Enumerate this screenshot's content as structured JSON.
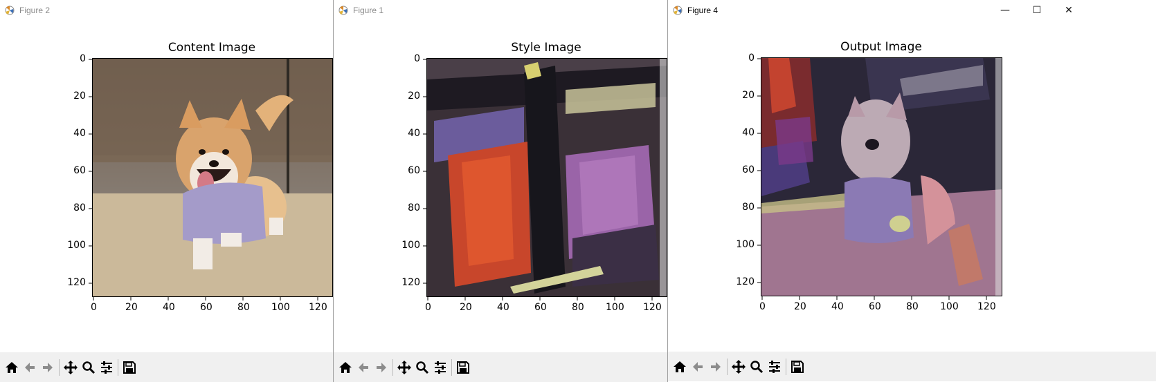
{
  "windows": [
    {
      "title": "Figure 2",
      "active": false,
      "plot_title": "Content Image",
      "image_subject": "corgi puppy in lavender shirt running on dry grass",
      "x_ticks": [
        "0",
        "20",
        "40",
        "60",
        "80",
        "100",
        "120"
      ],
      "y_ticks": [
        "0",
        "20",
        "40",
        "60",
        "80",
        "100",
        "120"
      ]
    },
    {
      "title": "Figure 1",
      "active": false,
      "plot_title": "Style Image",
      "image_subject": "abstract painting with dark cross, red and purple brushstrokes",
      "x_ticks": [
        "0",
        "20",
        "40",
        "60",
        "80",
        "100",
        "120"
      ],
      "y_ticks": [
        "0",
        "20",
        "40",
        "60",
        "80",
        "100",
        "120"
      ]
    },
    {
      "title": "Figure 4",
      "active": true,
      "plot_title": "Output Image",
      "image_subject": "corgi rendered in painterly style with red, purple and pink strokes",
      "x_ticks": [
        "0",
        "20",
        "40",
        "60",
        "80",
        "100",
        "120"
      ],
      "y_ticks": [
        "0",
        "20",
        "40",
        "60",
        "80",
        "100",
        "120"
      ]
    }
  ],
  "toolbar": {
    "icons": [
      "home-icon",
      "back-arrow-icon",
      "forward-arrow-icon",
      "pan-icon",
      "zoom-icon",
      "configure-subplots-icon",
      "save-icon"
    ]
  },
  "window_controls": {
    "minimize": "—",
    "maximize": "☐",
    "close": "✕"
  },
  "colors": {
    "toolbar_bg": "#f0f0f0",
    "plot_bg": "#ffffff"
  }
}
